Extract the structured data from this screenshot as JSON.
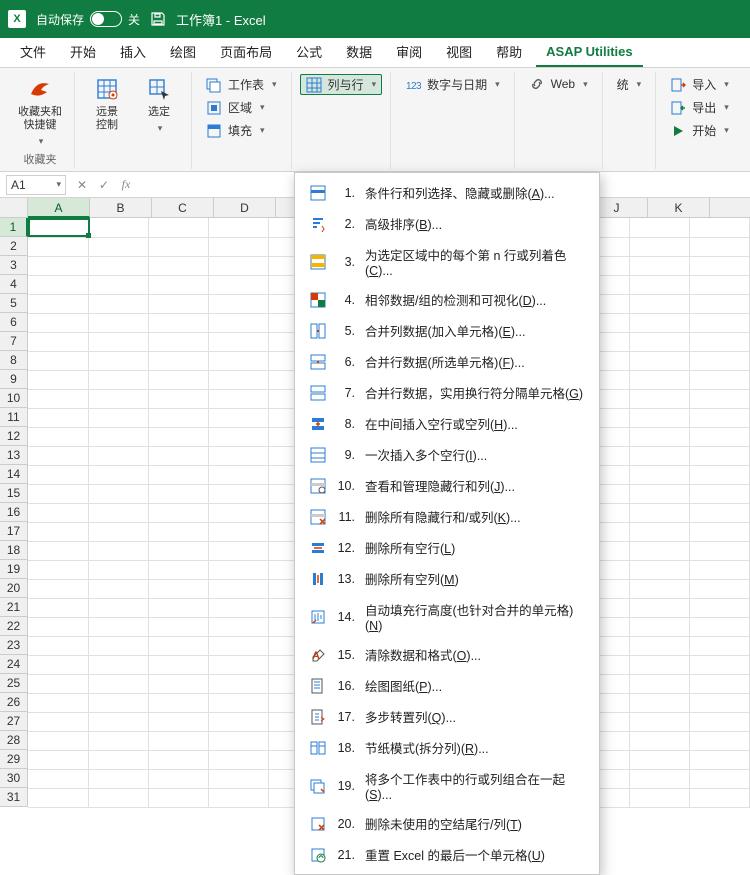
{
  "titlebar": {
    "autosave_label": "自动保存",
    "autosave_state": "关",
    "doc_title": "工作簿1  -  Excel"
  },
  "tabs": [
    {
      "label": "文件"
    },
    {
      "label": "开始"
    },
    {
      "label": "插入"
    },
    {
      "label": "绘图"
    },
    {
      "label": "页面布局"
    },
    {
      "label": "公式"
    },
    {
      "label": "数据"
    },
    {
      "label": "审阅"
    },
    {
      "label": "视图"
    },
    {
      "label": "帮助"
    },
    {
      "label": "ASAP Utilities",
      "active": true
    }
  ],
  "ribbon": {
    "favorites": {
      "big_label": "收藏夹和\n快捷键",
      "group_label": "收藏夹"
    },
    "vision": {
      "label": "远景\n控制"
    },
    "select": {
      "label": "选定"
    },
    "col1": {
      "worksheets": "工作表",
      "region": "区域",
      "fill": "填充"
    },
    "col2": {
      "cols_rows": "列与行"
    },
    "col3": {
      "numbers_date": "数字与日期"
    },
    "col4": {
      "web": "Web"
    },
    "col5_suffix": "统",
    "col6": {
      "import": "导入",
      "export": "导出",
      "start": "开始"
    }
  },
  "formula": {
    "namebox": "A1"
  },
  "columns": [
    "A",
    "B",
    "C",
    "D",
    "",
    "",
    "",
    "",
    "",
    "J",
    "K",
    ""
  ],
  "active_col_index": 0,
  "row_count": 31,
  "active_row": 1,
  "dropdown": [
    {
      "n": "1.",
      "label": "条件行和列选择、隐藏或删除(",
      "k": "A",
      "suffix": ")..."
    },
    {
      "n": "2.",
      "label": "高级排序(",
      "k": "B",
      "suffix": ")..."
    },
    {
      "n": "3.",
      "label": "为选定区域中的每个第 n 行或列着色(",
      "k": "C",
      "suffix": ")..."
    },
    {
      "n": "4.",
      "label": "相邻数据/组的检测和可视化(",
      "k": "D",
      "suffix": ")..."
    },
    {
      "n": "5.",
      "label": "合并列数据(加入单元格)(",
      "k": "E",
      "suffix": ")..."
    },
    {
      "n": "6.",
      "label": "合并行数据(所选单元格)(",
      "k": "F",
      "suffix": ")..."
    },
    {
      "n": "7.",
      "label": "合并行数据，实用换行符分隔单元格(",
      "k": "G",
      "suffix": ")"
    },
    {
      "n": "8.",
      "label": "在中间插入空行或空列(",
      "k": "H",
      "suffix": ")..."
    },
    {
      "n": "9.",
      "label": "一次插入多个空行(",
      "k": "I",
      "suffix": ")..."
    },
    {
      "n": "10.",
      "label": "查看和管理隐藏行和列(",
      "k": "J",
      "suffix": ")..."
    },
    {
      "n": "11.",
      "label": "删除所有隐藏行和/或列(",
      "k": "K",
      "suffix": ")..."
    },
    {
      "n": "12.",
      "label": "删除所有空行(",
      "k": "L",
      "suffix": ")"
    },
    {
      "n": "13.",
      "label": "删除所有空列(",
      "k": "M",
      "suffix": ")"
    },
    {
      "n": "14.",
      "label": "自动填充行高度(也针对合并的单元格)(",
      "k": "N",
      "suffix": ")"
    },
    {
      "n": "15.",
      "label": "清除数据和格式(",
      "k": "O",
      "suffix": ")..."
    },
    {
      "n": "16.",
      "label": "绘图图纸(",
      "k": "P",
      "suffix": ")..."
    },
    {
      "n": "17.",
      "label": "多步转置列(",
      "k": "Q",
      "suffix": ")..."
    },
    {
      "n": "18.",
      "label": "节纸模式(拆分列)(",
      "k": "R",
      "suffix": ")..."
    },
    {
      "n": "19.",
      "label": "将多个工作表中的行或列组合在一起(",
      "k": "S",
      "suffix": ")..."
    },
    {
      "n": "20.",
      "label": "删除未使用的空结尾行/列(",
      "k": "T",
      "suffix": ")"
    },
    {
      "n": "21.",
      "label": "重置 Excel 的最后一个单元格(",
      "k": "U",
      "suffix": ")"
    }
  ],
  "icons": {
    "colors": {
      "green": "#107c41",
      "blue": "#2b7cd3",
      "red": "#d83b01",
      "gray": "#666"
    }
  }
}
